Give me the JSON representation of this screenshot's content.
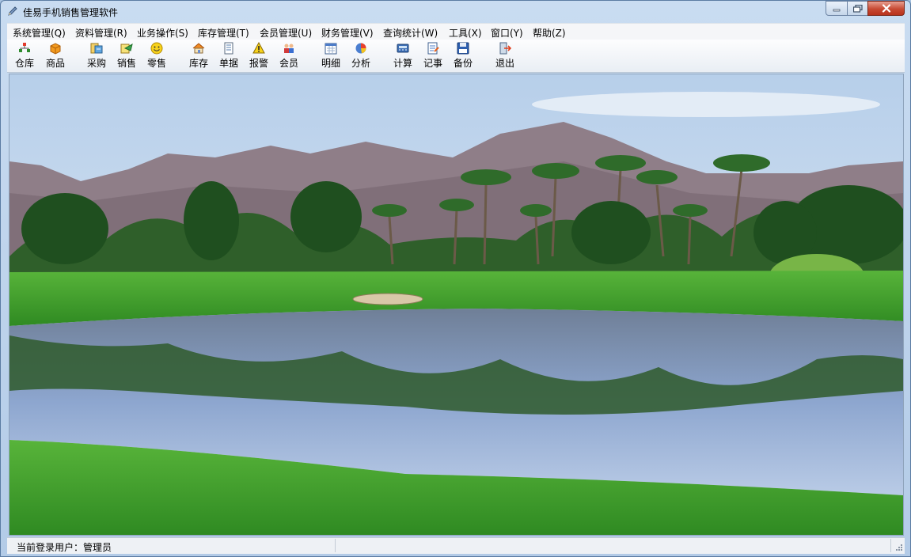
{
  "window": {
    "title": "佳易手机销售管理软件",
    "controls": {
      "minimize_icon": "minimize-icon",
      "maximize_icon": "maximize-icon",
      "close_icon": "close-icon"
    }
  },
  "menu": [
    "系统管理(Q)",
    "资料管理(R)",
    "业务操作(S)",
    "库存管理(T)",
    "会员管理(U)",
    "财务管理(V)",
    "查询统计(W)",
    "工具(X)",
    "窗口(Y)",
    "帮助(Z)"
  ],
  "toolbar": [
    {
      "label": "仓库",
      "icon": "warehouse-icon"
    },
    {
      "label": "商品",
      "icon": "product-box-icon"
    },
    {
      "label": "采购",
      "icon": "purchase-icon"
    },
    {
      "label": "销售",
      "icon": "sales-icon"
    },
    {
      "label": "零售",
      "icon": "smiley-icon"
    },
    {
      "label": "库存",
      "icon": "house-icon"
    },
    {
      "label": "单据",
      "icon": "document-icon"
    },
    {
      "label": "报警",
      "icon": "warning-icon"
    },
    {
      "label": "会员",
      "icon": "members-icon"
    },
    {
      "label": "明细",
      "icon": "calendar-icon"
    },
    {
      "label": "分析",
      "icon": "analysis-icon"
    },
    {
      "label": "计算",
      "icon": "calculator-icon"
    },
    {
      "label": "记事",
      "icon": "notepad-icon"
    },
    {
      "label": "备份",
      "icon": "floppy-disk-icon"
    },
    {
      "label": "退出",
      "icon": "exit-icon"
    }
  ],
  "colors": {
    "sky": "#cfe0f1",
    "mountain": "#8f7e88",
    "grass": "#3f9a2c",
    "water": "#8aa2c8",
    "accent_close": "#c74a33"
  },
  "status": {
    "user_text": "当前登录用户：管理员"
  }
}
